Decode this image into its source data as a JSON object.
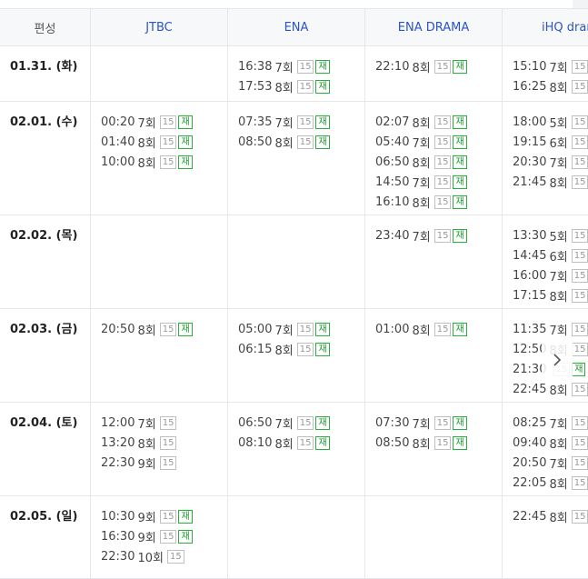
{
  "header": {
    "date_col": "편성",
    "channels": [
      "JTBC",
      "ENA",
      "ENA DRAMA",
      "iHQ dram"
    ]
  },
  "badges": {
    "rating": "15",
    "rerun": "재"
  },
  "rows": [
    {
      "date": "01.31. (화)",
      "cols": [
        [],
        [
          {
            "time": "16:38",
            "ep": "7회",
            "rerun": true
          },
          {
            "time": "17:53",
            "ep": "8회",
            "rerun": true
          }
        ],
        [
          {
            "time": "22:10",
            "ep": "8회",
            "rerun": true
          }
        ],
        [
          {
            "time": "15:10",
            "ep": "7회",
            "rerun": true
          },
          {
            "time": "16:25",
            "ep": "8회",
            "rerun": true
          }
        ]
      ]
    },
    {
      "date": "02.01. (수)",
      "cols": [
        [
          {
            "time": "00:20",
            "ep": "7회",
            "rerun": true
          },
          {
            "time": "01:40",
            "ep": "8회",
            "rerun": true
          },
          {
            "time": "10:00",
            "ep": "8회",
            "rerun": true
          }
        ],
        [
          {
            "time": "07:35",
            "ep": "7회",
            "rerun": true
          },
          {
            "time": "08:50",
            "ep": "8회",
            "rerun": true
          }
        ],
        [
          {
            "time": "02:07",
            "ep": "8회",
            "rerun": true
          },
          {
            "time": "05:40",
            "ep": "7회",
            "rerun": true
          },
          {
            "time": "06:50",
            "ep": "8회",
            "rerun": true
          },
          {
            "time": "14:50",
            "ep": "7회",
            "rerun": true
          },
          {
            "time": "16:10",
            "ep": "8회",
            "rerun": true
          }
        ],
        [
          {
            "time": "18:00",
            "ep": "5회",
            "rerun": true
          },
          {
            "time": "19:15",
            "ep": "6회",
            "rerun": true
          },
          {
            "time": "20:30",
            "ep": "7회",
            "rerun": true
          },
          {
            "time": "21:45",
            "ep": "8회",
            "rerun": true
          }
        ]
      ]
    },
    {
      "date": "02.02. (목)",
      "cols": [
        [],
        [],
        [
          {
            "time": "23:40",
            "ep": "7회",
            "rerun": true
          }
        ],
        [
          {
            "time": "13:30",
            "ep": "5회",
            "rerun": true
          },
          {
            "time": "14:45",
            "ep": "6회",
            "rerun": true
          },
          {
            "time": "16:00",
            "ep": "7회",
            "rerun": true
          },
          {
            "time": "17:15",
            "ep": "8회",
            "rerun": true
          }
        ]
      ]
    },
    {
      "date": "02.03. (금)",
      "cols": [
        [
          {
            "time": "20:50",
            "ep": "8회",
            "rerun": true
          }
        ],
        [
          {
            "time": "05:00",
            "ep": "7회",
            "rerun": true
          },
          {
            "time": "06:15",
            "ep": "8회",
            "rerun": true
          }
        ],
        [
          {
            "time": "01:00",
            "ep": "8회",
            "rerun": true
          }
        ],
        [
          {
            "time": "11:35",
            "ep": "7회",
            "rerun": true
          },
          {
            "time": "12:50",
            "ep": "8회",
            "rerun": true
          },
          {
            "time": "21:30",
            "ep": "",
            "rerun": true
          },
          {
            "time": "22:45",
            "ep": "8회",
            "rerun": true
          }
        ]
      ]
    },
    {
      "date": "02.04. (토)",
      "cols": [
        [
          {
            "time": "12:00",
            "ep": "7회",
            "rerun": false
          },
          {
            "time": "13:20",
            "ep": "8회",
            "rerun": false
          },
          {
            "time": "22:30",
            "ep": "9회",
            "rerun": false
          }
        ],
        [
          {
            "time": "06:50",
            "ep": "7회",
            "rerun": true
          },
          {
            "time": "08:10",
            "ep": "8회",
            "rerun": true
          }
        ],
        [
          {
            "time": "07:30",
            "ep": "7회",
            "rerun": true
          },
          {
            "time": "08:50",
            "ep": "8회",
            "rerun": true
          }
        ],
        [
          {
            "time": "08:25",
            "ep": "7회",
            "rerun": true
          },
          {
            "time": "09:40",
            "ep": "8회",
            "rerun": true
          },
          {
            "time": "20:50",
            "ep": "7회",
            "rerun": true
          },
          {
            "time": "22:05",
            "ep": "8회",
            "rerun": true
          }
        ]
      ]
    },
    {
      "date": "02.05. (일)",
      "cols": [
        [
          {
            "time": "10:30",
            "ep": "9회",
            "rerun": true
          },
          {
            "time": "16:30",
            "ep": "9회",
            "rerun": true
          },
          {
            "time": "22:30",
            "ep": "10회",
            "rerun": false
          }
        ],
        [],
        [],
        [
          {
            "time": "22:45",
            "ep": "8회",
            "rerun": true
          }
        ]
      ]
    }
  ]
}
